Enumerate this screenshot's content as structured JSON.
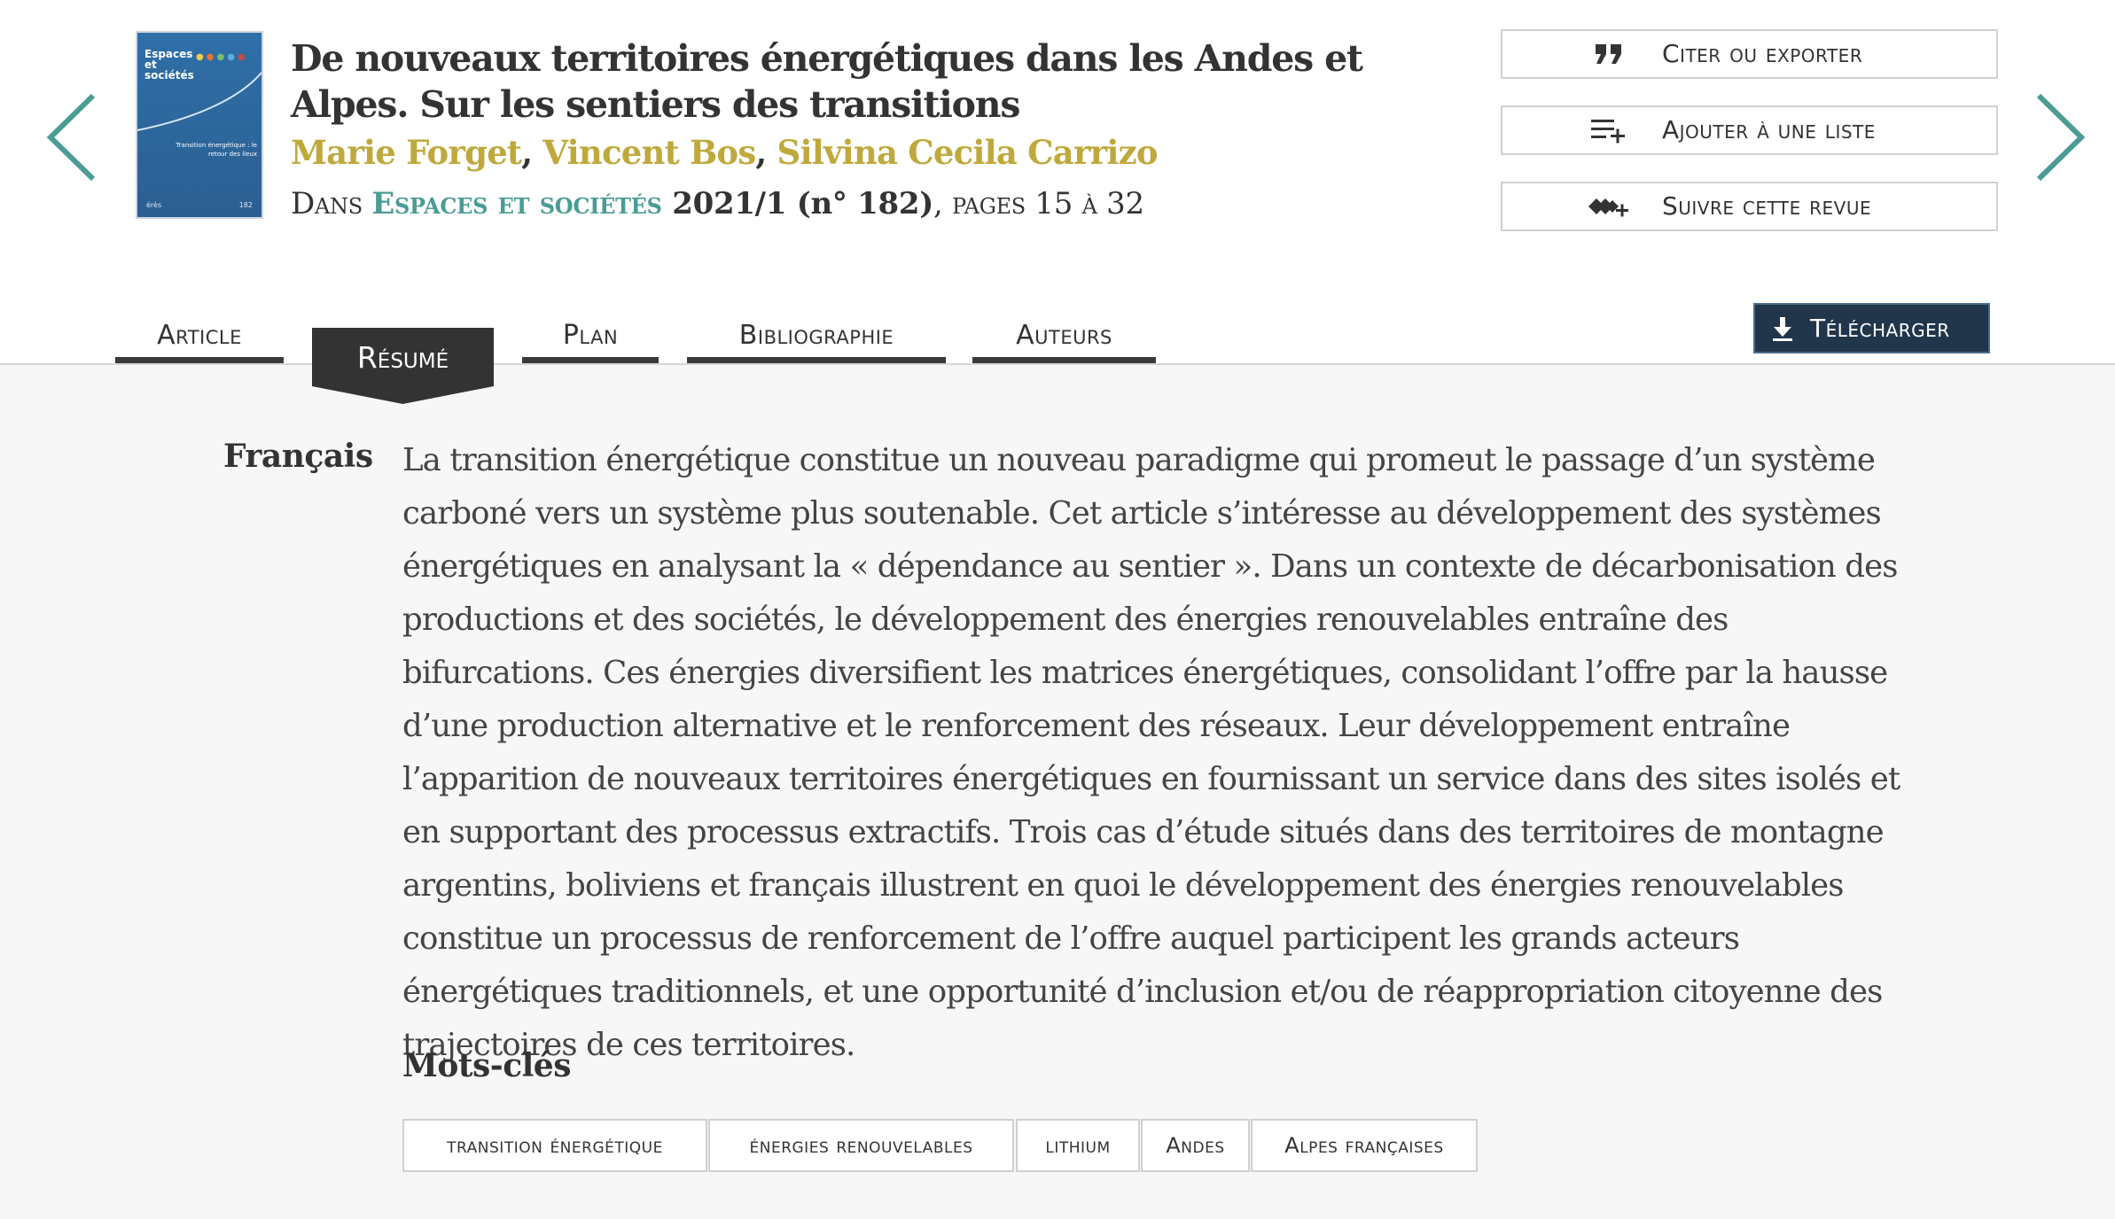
{
  "article": {
    "title": "De nouveaux territoires énergétiques dans les Andes et Alpes. Sur les sentiers des transitions",
    "authors": [
      "Marie Forget",
      "Vincent Bos",
      "Silvina Cecila Carrizo"
    ],
    "author_separator": ", ",
    "issue_prefix": "Dans ",
    "journal": "Espaces et sociétés",
    "issue": " 2021/1 (n° 182)",
    "pages": ", pages 15 à 32"
  },
  "cover": {
    "journal_title": "Espaces et sociétés",
    "subtitle": "Transition énergétique : le retour des lieux",
    "publisher": "érès",
    "number": "182"
  },
  "actions": {
    "cite_label": "Citer ou exporter",
    "list_label": "Ajouter à une liste",
    "follow_label": "Suivre cette revue"
  },
  "tabs": {
    "article": "Article",
    "resume": "Résumé",
    "plan": "Plan",
    "bibliography": "Bibliographie",
    "authors": "Auteurs"
  },
  "download_label": "Télécharger",
  "abstract": {
    "language": "Français",
    "text": "La transition énergétique constitue un nouveau paradigme qui promeut le passage d’un système carboné vers un système plus soutenable. Cet article s’intéresse au développement des systèmes énergétiques en analysant la « dépendance au sentier ». Dans un contexte de décarbonisation des productions et des sociétés, le développement des énergies renouvelables entraîne des bifurcations. Ces énergies diversifient les matrices énergétiques, consolidant l’offre par la hausse d’une production alternative et le renforcement des réseaux. Leur développement entraîne l’apparition de nouveaux territoires énergétiques en fournissant un service dans des sites isolés et en supportant des processus extractifs. Trois cas d’étude situés dans des territoires de montagne argentins, boliviens et français illustrent en quoi le développement des énergies renouvelables constitue un processus de renforcement de l’offre auquel participent les grands acteurs énergétiques traditionnels, et une opportunité d’inclusion et/ou de réappropriation citoyenne des trajectoires de ces territoires."
  },
  "keywords": {
    "heading": "Mots-clés",
    "items": [
      "transition énergétique",
      "énergies renouvelables",
      "lithium",
      "Andes",
      "Alpes françaises"
    ]
  },
  "colors": {
    "accent_teal": "#4a9c94",
    "author_gold": "#bfa93c",
    "download_bg": "#21364a",
    "active_tab_bg": "#333333"
  },
  "icons": {
    "prev": "chevron-left-icon",
    "next": "chevron-right-icon",
    "cite": "quote-icon",
    "list": "playlist-add-icon",
    "follow": "follow-journal-icon",
    "download": "download-icon"
  }
}
